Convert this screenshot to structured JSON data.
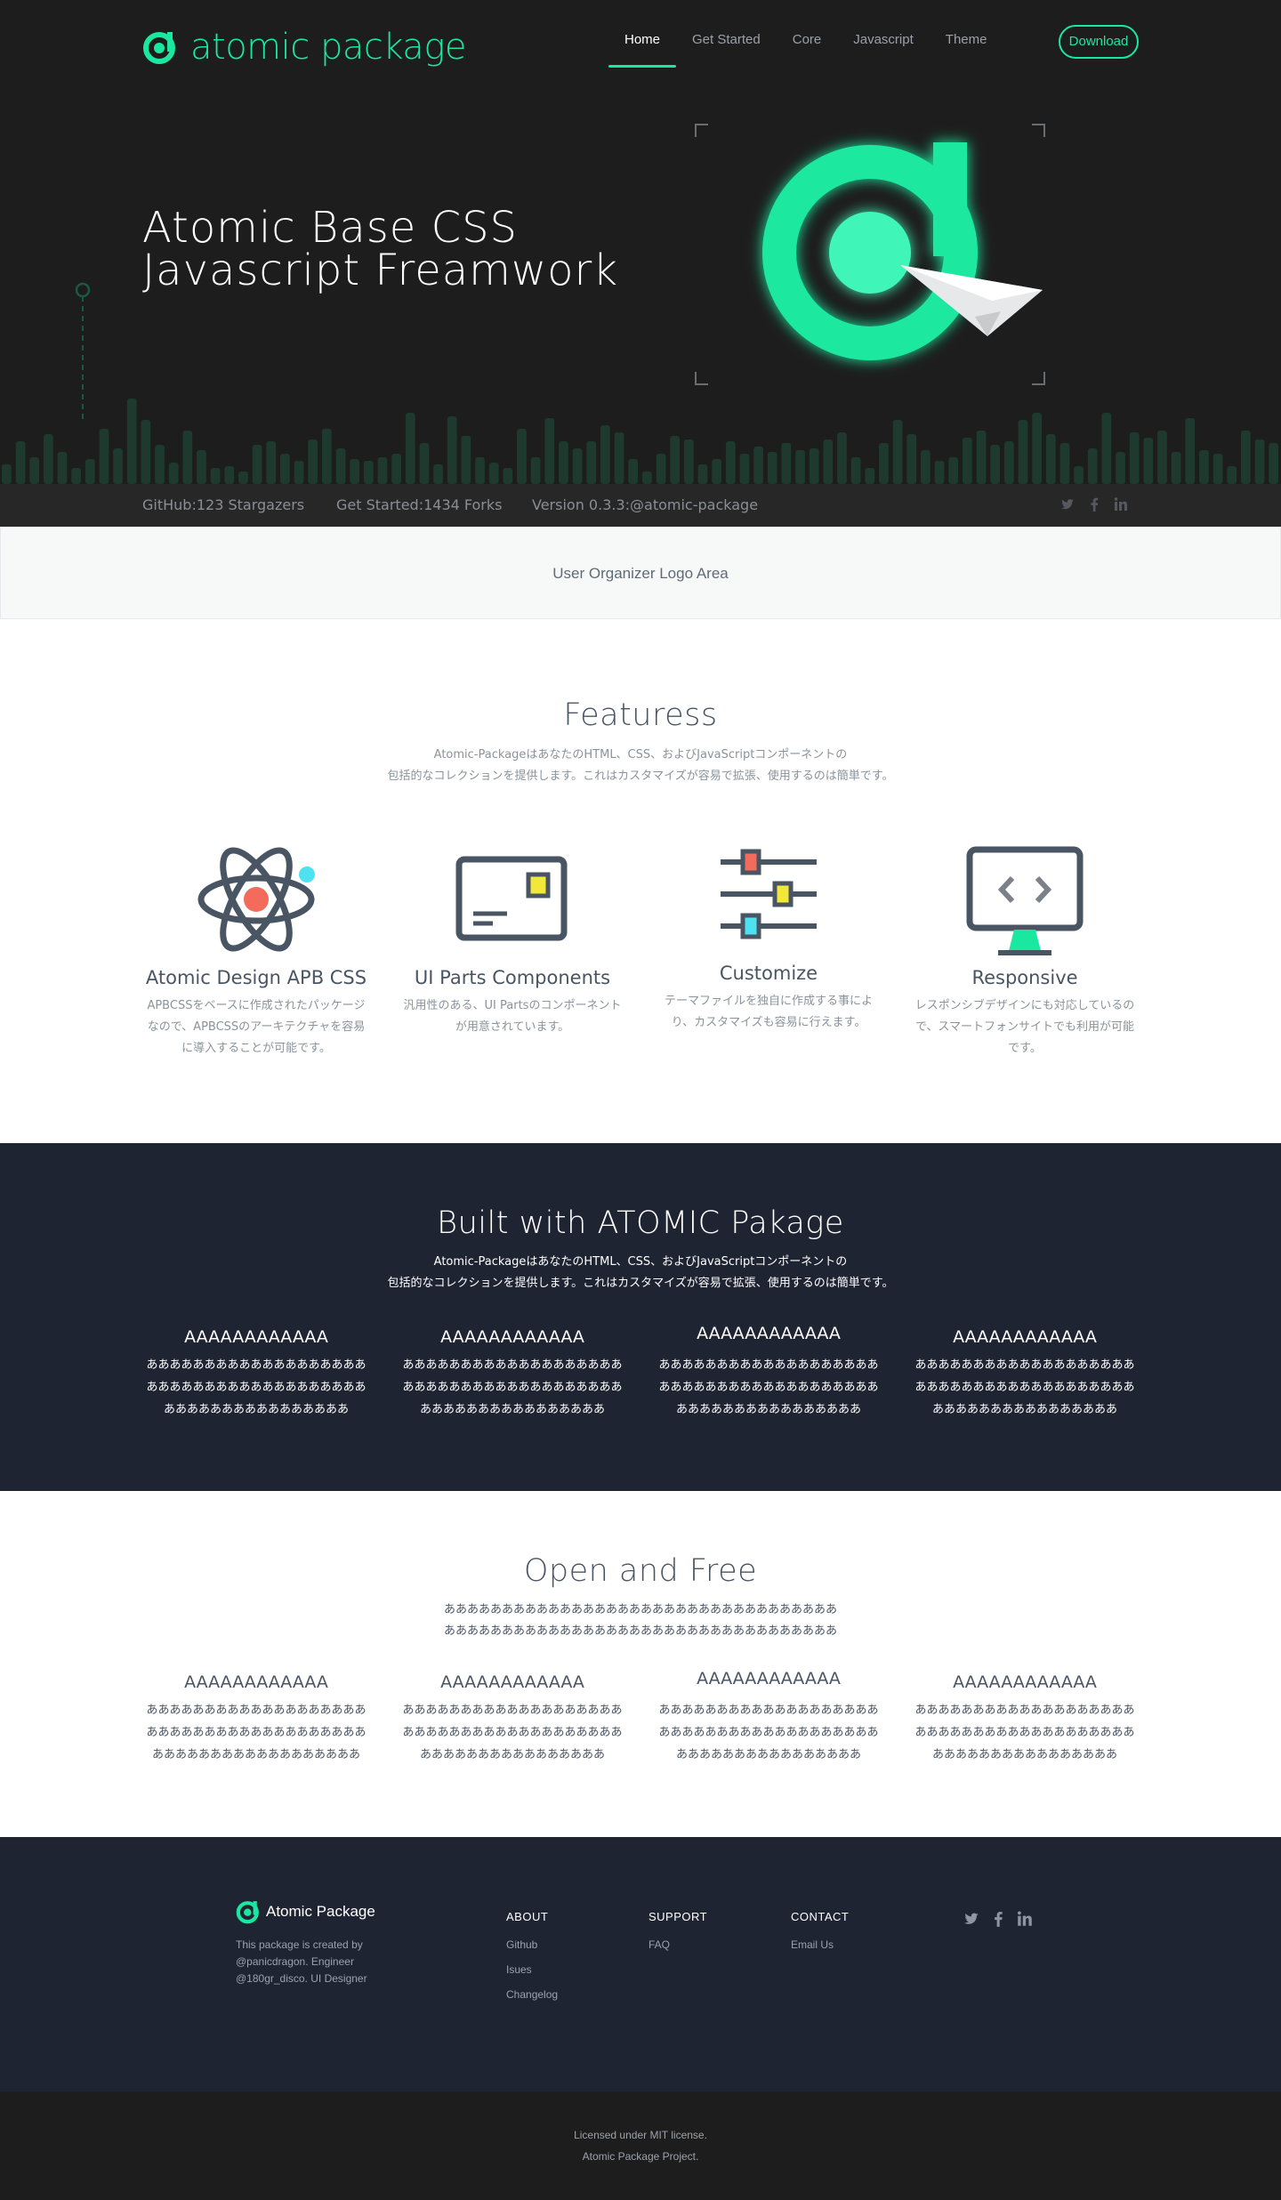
{
  "brand": {
    "name": "atomic package"
  },
  "nav": {
    "items": [
      {
        "label": "Home"
      },
      {
        "label": "Get Started"
      },
      {
        "label": "Core"
      },
      {
        "label": "Javascript"
      },
      {
        "label": "Theme"
      }
    ],
    "download_label": "Download"
  },
  "hero": {
    "title_line1": "Atomic Base CSS",
    "title_line2": "Javascript Freamwork"
  },
  "stats": {
    "github": "GitHub:123 Stargazers",
    "started": "Get Started:1434 Forks",
    "version": "Version 0.3.3:@atomic-package",
    "social_icons": [
      "twitter-icon",
      "facebook-icon",
      "linkedin-icon"
    ]
  },
  "org_area": {
    "label": "User Organizer Logo Area"
  },
  "features": {
    "title": "Featuress",
    "desc_line1": "Atomic-PackageはあなたのHTML、CSS、およびJavaScriptコンポーネントの",
    "desc_line2": "包括的なコレクションを提供します。これはカスタマイズが容易で拡張、使用するのは簡単です。",
    "items": [
      {
        "icon": "atom-icon",
        "title": "Atomic Design APB CSS",
        "desc": "APBCSSをベースに作成されたパッケージなので、APBCSSのアーキテクチャを容易に導入することが可能です。"
      },
      {
        "icon": "card-icon",
        "title": "UI Parts Components",
        "desc": "汎用性のある、UI Partsのコンポーネントが用意されています。"
      },
      {
        "icon": "sliders-icon",
        "title": "Customize",
        "desc": "テーマファイルを独自に作成する事により、カスタマイズも容易に行えます。"
      },
      {
        "icon": "monitor-code-icon",
        "title": "Responsive",
        "desc": "レスポンシブデザインにも対応しているので、スマートフォンサイトでも利用が可能です。"
      }
    ]
  },
  "built": {
    "title": "Built with ATOMIC Pakage",
    "desc_line1": "Atomic-PackageはあなたのHTML、CSS、およびJavaScriptコンポーネントの",
    "desc_line2": "包括的なコレクションを提供します。これはカスタマイズが容易で拡張、使用するのは簡単です。",
    "items": [
      {
        "head": "AAAAAAAAAAAA",
        "text": "ああああああああああああああああああああああああああああああああああああああああああああああああああああああ"
      },
      {
        "head": "AAAAAAAAAAAA",
        "text": "ああああああああああああああああああああああああああああああああああああああああああああああああああああああ"
      },
      {
        "head": "AAAAAAAAAAAA",
        "text": "ああああああああああああああああああああああああああああああああああああああああああああああああああああああ"
      },
      {
        "head": "AAAAAAAAAAAA",
        "text": "ああああああああああああああああああああああああああああああああああああああああああああああああああああああ"
      }
    ]
  },
  "open": {
    "title": "Open and Free",
    "desc_line1": "ああああああああああああああああああああああああああああああああああ",
    "desc_line2": "ああああああああああああああああああああああああああああああああああ",
    "items": [
      {
        "head": "AAAAAAAAAAAA",
        "text": "ああああああああああああああああああああああああああああああああああああああああああああああああああああああああ"
      },
      {
        "head": "AAAAAAAAAAAA",
        "text": "ああああああああああああああああああああああああああああああああああああああああああああああああああああああ"
      },
      {
        "head": "AAAAAAAAAAAA",
        "text": "ああああああああああああああああああああああああああああああああああああああああああああああああああああああ"
      },
      {
        "head": "AAAAAAAAAAAA",
        "text": "ああああああああああああああああああああああああああああああああああああああああああああああああああああああ"
      }
    ]
  },
  "footer": {
    "brand_name": "Atomic Package",
    "about_line1": "This package is created by",
    "about_line2": "@panicdragon. Engineer",
    "about_line3": "@180gr_disco. UI Designer",
    "cols": [
      {
        "title": "ABOUT",
        "links": [
          "Github",
          "Isues",
          "Changelog"
        ]
      },
      {
        "title": "SUPPORT",
        "links": [
          "FAQ"
        ]
      },
      {
        "title": "CONTACT",
        "links": [
          "Email Us"
        ]
      }
    ],
    "social_icons": [
      "twitter-icon",
      "facebook-icon",
      "linkedin-icon"
    ]
  },
  "copyright": {
    "line1": "Licensed under MIT license.",
    "line2": "Atomic Package Project."
  },
  "colors": {
    "accent": "#1be8a0",
    "hero_bg": "#1d1d1d",
    "navy": "#1f2433",
    "text": "#4a5563"
  }
}
